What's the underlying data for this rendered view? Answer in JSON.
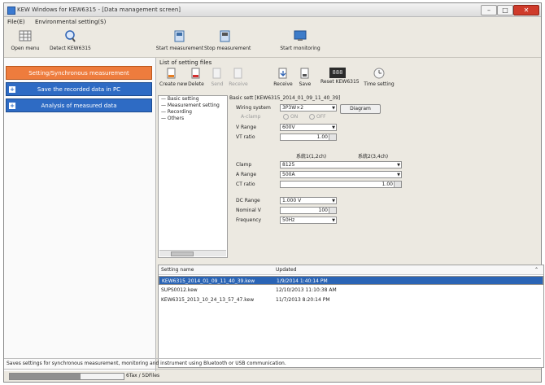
{
  "window": {
    "title": "KEW Windows for KEW6315 - [Data management screen]",
    "min_label": "–",
    "max_label": "□",
    "close_label": "✕"
  },
  "menu": [
    {
      "label": "File(E)"
    },
    {
      "label": "Environmental setting(S)"
    }
  ],
  "toolbar": [
    {
      "label": "Open menu"
    },
    {
      "label": "Detect KEW6315"
    },
    {
      "label": "Start measurement"
    },
    {
      "label": "Stop measurement"
    },
    {
      "label": "Start monitoring"
    }
  ],
  "nav": [
    {
      "label": "Setting/Synchronous measurement"
    },
    {
      "label": "Save the recorded data in PC",
      "expander": "+"
    },
    {
      "label": "Analysis of measured data",
      "expander": "+"
    }
  ],
  "main": {
    "section_title": "List of setting files",
    "file_toolbar": [
      {
        "label": "Create new"
      },
      {
        "label": "Delete"
      },
      {
        "label": "Send"
      },
      {
        "label": "Receive"
      },
      {
        "label": "Receive"
      },
      {
        "label": "Save"
      },
      {
        "label": "Reset KEW6315"
      },
      {
        "label": "Time setting"
      }
    ],
    "reset_display": "888",
    "tree": [
      {
        "label": "Basic setting"
      },
      {
        "label": "Measurement setting"
      },
      {
        "label": "Recording"
      },
      {
        "label": "Others"
      }
    ],
    "basic": {
      "header": "Basic sett [KEW6315_2014_01_09_11_40_39]",
      "wiring_label": "Wiring system",
      "wiring_value": "3P3W×2",
      "diagram_button": "Diagram",
      "a_clamp_label": "A-clamp",
      "a_on": "ON",
      "a_off": "OFF",
      "v_range_label": "V Range",
      "v_range_value": "600V",
      "vt_ratio_label": "VT ratio",
      "vt_ratio_value": "1.00",
      "ch_header_1": "系統1(1,2ch)",
      "ch_header_2": "系統2(3,4ch)",
      "clamp_label": "Clamp",
      "clamp_value": "8125",
      "a_range_label": "A Range",
      "a_range_value": "500A",
      "ct_ratio_label": "CT ratio",
      "ct_ratio_value": "1.00",
      "dc_range_label": "DC Range",
      "dc_range_value": "1.000 V",
      "nominal_v_label": "Nominal V",
      "nominal_v_value": "100",
      "frequency_label": "Frequency",
      "frequency_value": "50Hz"
    },
    "files": {
      "col_name": "Setting name",
      "col_updated": "Updated",
      "sort_icon": "⌃",
      "rows": [
        {
          "name": "KEW6315_2014_01_09_11_40_39.kew",
          "updated": "1/9/2014 1:40:14 PM",
          "selected": true
        },
        {
          "name": "SUPS0012.kew",
          "updated": "12/10/2013 11:10:38 AM",
          "selected": false
        },
        {
          "name": "KEW6315_2013_10_24_13_57_47.kew",
          "updated": "11/7/2013 8:20:14 PM",
          "selected": false
        }
      ]
    }
  },
  "status_text": "Saves settings for synchronous measurement, monitoring and instrument using Bluetooth or USB communication.",
  "bottom": {
    "progress": 0.62,
    "text": "6Tax / 5DFiles"
  }
}
